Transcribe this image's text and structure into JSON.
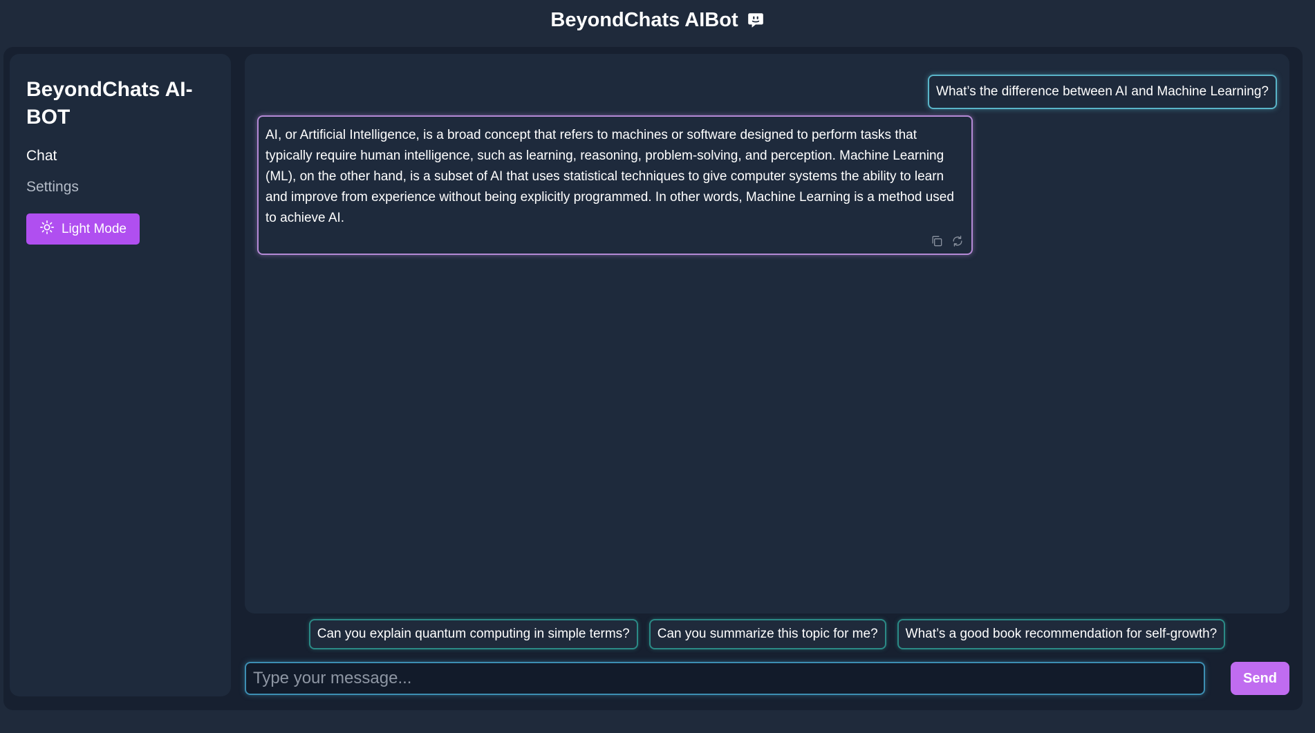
{
  "header": {
    "title": "BeyondChats AIBot",
    "title_icon": "chat-bubble-icon"
  },
  "sidebar": {
    "brand": "BeyondChats AI-BOT",
    "nav": [
      {
        "label": "Chat"
      },
      {
        "label": "Settings"
      }
    ],
    "mode_button": {
      "label": "Light Mode",
      "icon": "sun-icon",
      "color": "#b04ff0"
    }
  },
  "chat": {
    "messages": [
      {
        "role": "user",
        "text": "What’s the difference between AI and Machine Learning?"
      },
      {
        "role": "bot",
        "text": "AI, or Artificial Intelligence, is a broad concept that refers to machines or software designed to perform tasks that typically require human intelligence, such as learning, reasoning, problem-solving, and perception. Machine Learning (ML), on the other hand, is a subset of AI that uses statistical techniques to give computer systems the ability to learn and improve from experience without being explicitly programmed. In other words, Machine Learning is a method used to achieve AI.",
        "actions": [
          "copy-icon",
          "refresh-icon"
        ]
      }
    ]
  },
  "suggestions": [
    "Can you explain quantum computing in simple terms?",
    "Can you summarize this topic for me?",
    "What’s a good book recommendation for self-growth?"
  ],
  "composer": {
    "placeholder": "Type your message...",
    "send_label": "Send",
    "send_color": "#c06cf0"
  }
}
